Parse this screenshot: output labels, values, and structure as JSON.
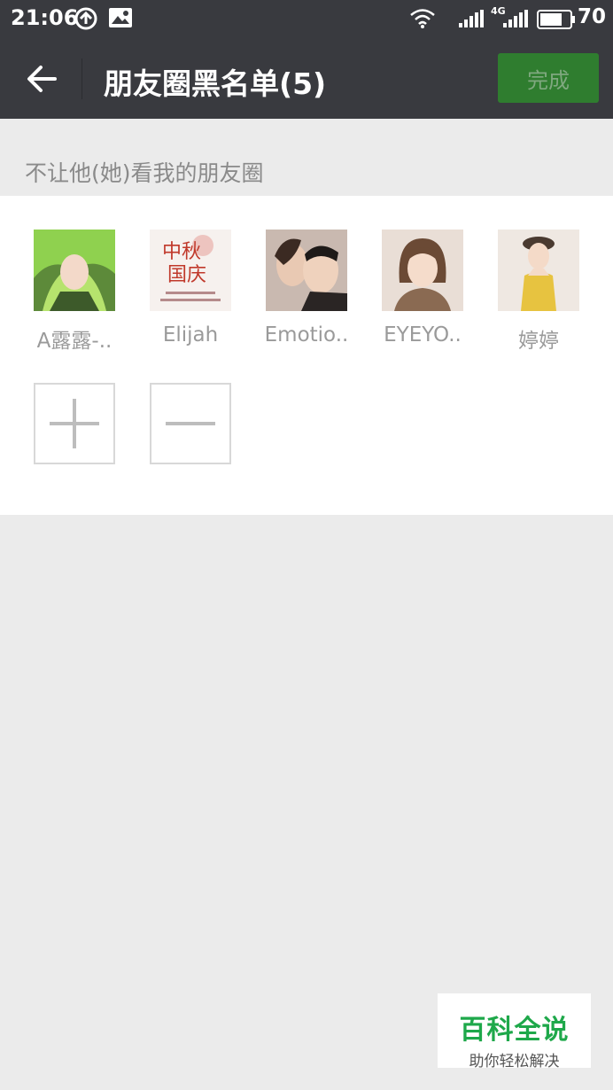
{
  "status_bar": {
    "time": "21:06",
    "network": "4G",
    "battery": "70",
    "icons": [
      "sync-icon",
      "image-icon",
      "wifi-icon",
      "signal-icon",
      "signal-4g-icon",
      "battery-icon"
    ]
  },
  "nav": {
    "back_icon": "arrow-left-icon",
    "title": "朋友圈黑名单(5)",
    "done_label": "完成"
  },
  "section": {
    "header": "不让他(她)看我的朋友圈"
  },
  "members": [
    {
      "name": "A露露-..",
      "avatar": "anime-green-hair-avatar"
    },
    {
      "name": "Elijah",
      "avatar": "mid-autumn-poster-avatar"
    },
    {
      "name": "Emotio..",
      "avatar": "couple-photo-avatar"
    },
    {
      "name": "EYEYO..",
      "avatar": "short-hair-girl-avatar"
    },
    {
      "name": "婷婷",
      "avatar": "girl-yellow-dress-avatar"
    }
  ],
  "actions": {
    "add_icon": "plus-icon",
    "remove_icon": "minus-icon"
  },
  "watermark": {
    "title": "百科全说",
    "subtitle": "助你轻松解决"
  },
  "colors": {
    "bar": "#393a3f",
    "done_button": "#2f7d2f",
    "background": "#ebebeb",
    "watermark_green": "#1ea84a"
  }
}
